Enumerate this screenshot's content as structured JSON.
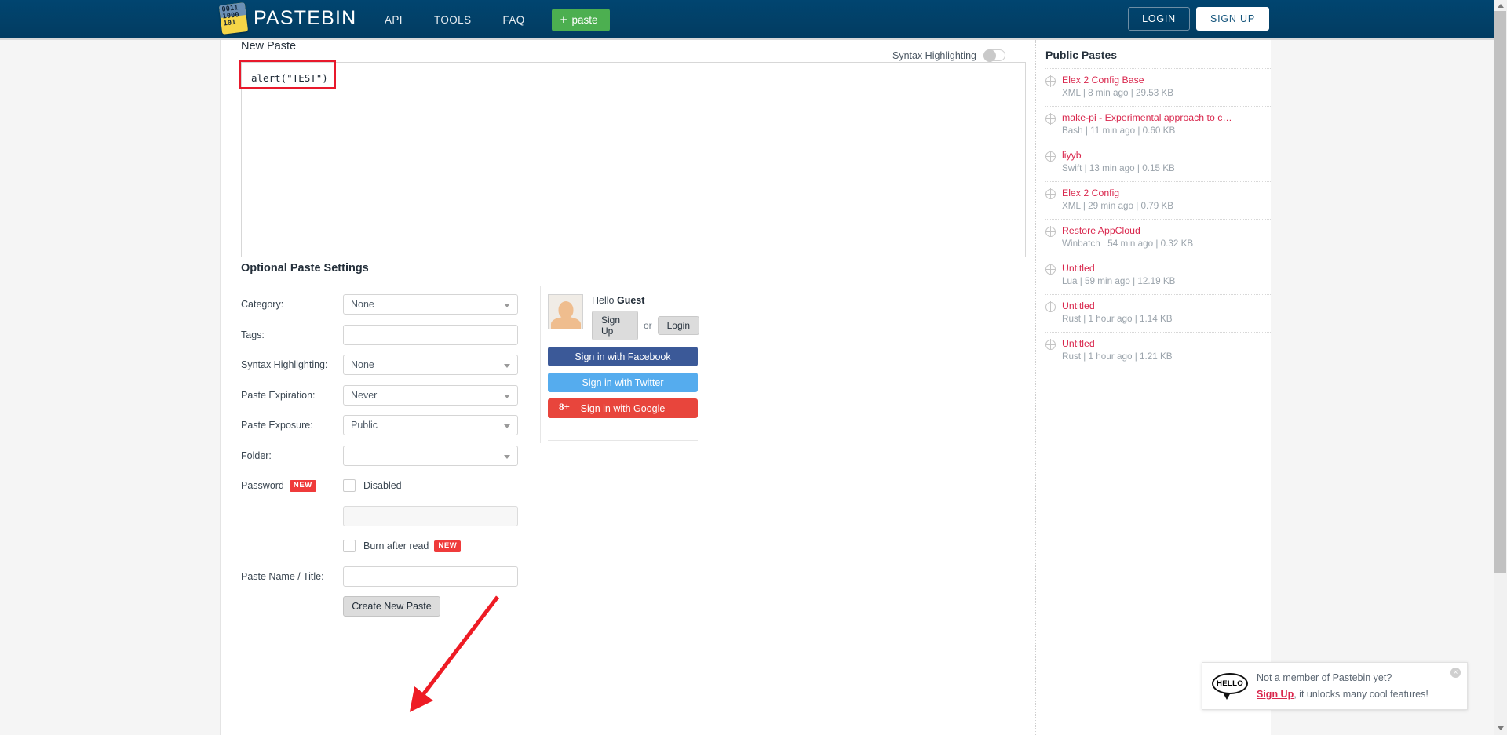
{
  "header": {
    "brand": "PASTEBIN",
    "logo_digits": "0011\n1000\n101",
    "nav": [
      {
        "label": "API"
      },
      {
        "label": "TOOLS"
      },
      {
        "label": "FAQ"
      }
    ],
    "paste_button": "paste",
    "login_button": "LOGIN",
    "signup_button": "SIGN UP"
  },
  "new_paste": {
    "heading": "New Paste",
    "syntax_toggle_label": "Syntax Highlighting",
    "syntax_toggle_state": "off",
    "textarea_value": "alert(\"TEST\")",
    "textarea_placeholder": ""
  },
  "optional_settings": {
    "heading": "Optional Paste Settings",
    "rows": [
      {
        "label": "Category:",
        "type": "select",
        "value": "None"
      },
      {
        "label": "Tags:",
        "type": "text",
        "value": ""
      },
      {
        "label": "Syntax Highlighting:",
        "type": "select",
        "value": "None"
      },
      {
        "label": "Paste Expiration:",
        "type": "select",
        "value": "Never"
      },
      {
        "label": "Paste Exposure:",
        "type": "select",
        "value": "Public"
      },
      {
        "label": "Folder:",
        "type": "select",
        "value": ""
      }
    ],
    "password": {
      "label": "Password",
      "badge": "NEW",
      "checkbox_label": "Disabled",
      "checked": false,
      "field_value": ""
    },
    "burn_after_read": {
      "label": "Burn after read",
      "badge": "NEW",
      "checked": false
    },
    "paste_name": {
      "label": "Paste Name / Title:",
      "value": ""
    },
    "create_button": "Create New Paste"
  },
  "login_panel": {
    "greeting_prefix": "Hello ",
    "greeting_name": "Guest",
    "signup_button": "Sign Up",
    "or_text": "or",
    "login_button": "Login",
    "social": [
      {
        "label": "Sign in with Facebook",
        "color": "#3b5998"
      },
      {
        "label": "Sign in with Twitter",
        "color": "#55acee"
      },
      {
        "label": "Sign in with Google",
        "color": "#e8453c",
        "icon": "8+"
      }
    ]
  },
  "public_pastes": {
    "title": "Public Pastes",
    "items": [
      {
        "title": "Elex 2 Config Base",
        "meta": "XML | 8 min ago | 29.53 KB"
      },
      {
        "title": "make-pi - Experimental approach to calculate…",
        "meta": "Bash | 11 min ago | 0.60 KB"
      },
      {
        "title": "liyyb",
        "meta": "Swift | 13 min ago | 0.15 KB"
      },
      {
        "title": "Elex 2 Config",
        "meta": "XML | 29 min ago | 0.79 KB"
      },
      {
        "title": "Restore AppCloud",
        "meta": "Winbatch | 54 min ago | 0.32 KB"
      },
      {
        "title": "Untitled",
        "meta": "Lua | 59 min ago | 12.19 KB"
      },
      {
        "title": "Untitled",
        "meta": "Rust | 1 hour ago | 1.14 KB"
      },
      {
        "title": "Untitled",
        "meta": "Rust | 1 hour ago | 1.21 KB"
      }
    ]
  },
  "notification": {
    "icon_text": "HELLO",
    "line1": "Not a member of Pastebin yet?",
    "link": "Sign Up",
    "line2_rest": ", it unlocks many cool features!",
    "close": "×"
  },
  "colors": {
    "header_bg": "#023c61",
    "accent_green": "#4caf50",
    "link_red": "#d9274d",
    "badge_red": "#ef3b3b",
    "annotation_red": "#e8192c"
  }
}
